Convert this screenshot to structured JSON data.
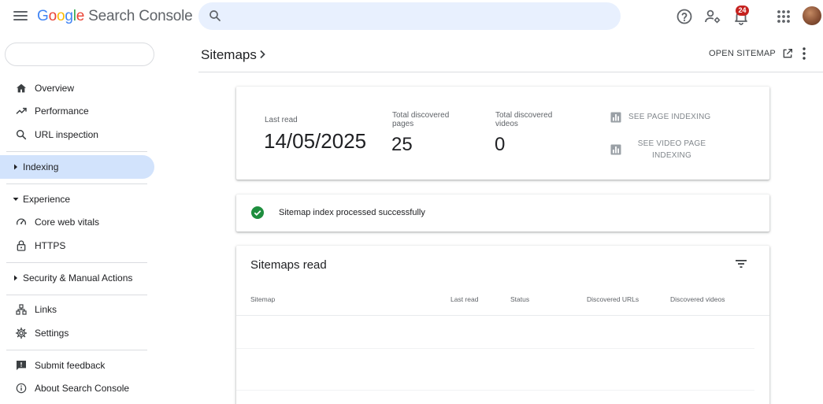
{
  "app": {
    "brand_letters": [
      "G",
      "o",
      "o",
      "g",
      "l",
      "e"
    ],
    "product": "Search Console",
    "search_placeholder": "",
    "notification_count": "24"
  },
  "sidebar": {
    "property_selector": "",
    "items": [
      {
        "label": "Overview",
        "icon": "home-icon"
      },
      {
        "label": "Performance",
        "icon": "trending-up-icon"
      },
      {
        "label": "URL inspection",
        "icon": "search-icon"
      }
    ],
    "indexing": {
      "label": "Indexing"
    },
    "experience": {
      "label": "Experience"
    },
    "experience_items": [
      {
        "label": "Core web vitals",
        "icon": "speed-gauge-icon"
      },
      {
        "label": "HTTPS",
        "icon": "lock-icon"
      }
    ],
    "security": {
      "label": "Security & Manual Actions"
    },
    "bottom_items": [
      {
        "label": "Links",
        "icon": "links-icon"
      },
      {
        "label": "Settings",
        "icon": "gear-icon"
      }
    ],
    "footer_items": [
      {
        "label": "Submit feedback",
        "icon": "feedback-icon"
      },
      {
        "label": "About Search Console",
        "icon": "info-icon"
      }
    ]
  },
  "header": {
    "title": "Sitemaps",
    "open_sitemap": "OPEN SITEMAP"
  },
  "stats": {
    "last_read_label": "Last read",
    "last_read_value": "14/05/2025",
    "pages_label_1": "Total discovered",
    "pages_label_2": "pages",
    "pages_value": "25",
    "videos_label_1": "Total discovered",
    "videos_label_2": "videos",
    "videos_value": "0",
    "see_page_indexing": "SEE PAGE INDEXING",
    "see_video_1": "SEE VIDEO PAGE",
    "see_video_2": "INDEXING"
  },
  "status": {
    "message": "Sitemap index processed successfully",
    "color": "#1e8e3e"
  },
  "table": {
    "title": "Sitemaps read",
    "columns": [
      "Sitemap",
      "Last read",
      "Status",
      "Discovered URLs",
      "Discovered videos"
    ]
  },
  "colors": {
    "accent": "#1a73e8",
    "active_nav": "#d2e3fc",
    "search_bg": "#e8f0fe",
    "badge": "#c5221f"
  }
}
